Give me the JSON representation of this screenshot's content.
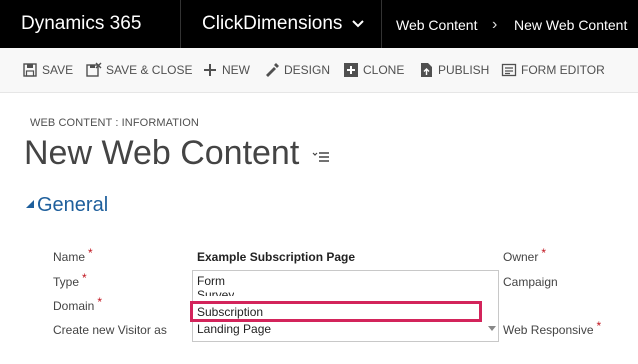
{
  "header": {
    "brand": "Dynamics 365",
    "app": "ClickDimensions",
    "breadcrumb": [
      "Web Content",
      "New Web Content"
    ],
    "separator": "›"
  },
  "toolbar": {
    "save": "SAVE",
    "save_close": "SAVE & CLOSE",
    "new": "NEW",
    "design": "DESIGN",
    "clone": "CLONE",
    "publish": "PUBLISH",
    "form_editor": "FORM EDITOR"
  },
  "form": {
    "type_label": "WEB CONTENT : INFORMATION",
    "title": "New Web Content",
    "section": "General"
  },
  "fields": {
    "name_label": "Name",
    "name_value": "Example Subscription Page",
    "type_label": "Type",
    "domain_label": "Domain",
    "visitor_label": "Create new Visitor as",
    "owner_label": "Owner",
    "campaign_label": "Campaign",
    "responsive_label": "Web Responsive",
    "required_mark": "*",
    "type_options": [
      "Form",
      "Survey",
      "Subscription",
      "Landing Page"
    ],
    "type_selected": "Subscription"
  },
  "colors": {
    "accent": "#1e5f9c",
    "required": "#c0141e",
    "highlight": "#d3245b"
  }
}
